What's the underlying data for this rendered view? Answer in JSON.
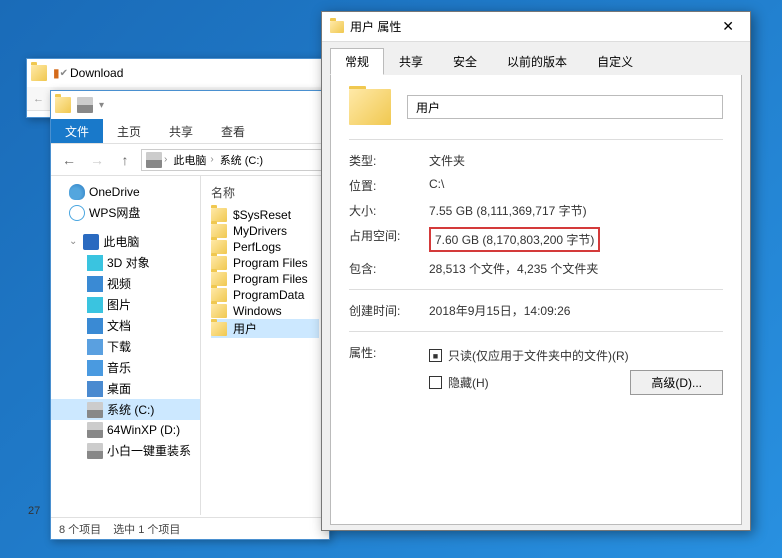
{
  "download_window": {
    "title": "Download",
    "addr_hint": "系统 (C:)"
  },
  "explorer": {
    "ribbon": {
      "file": "文件",
      "home": "主页",
      "share": "共享",
      "view": "查看"
    },
    "breadcrumbs": {
      "pc": "此电脑",
      "drive": "系统 (C:)"
    },
    "tree": {
      "onedrive": "OneDrive",
      "wps": "WPS网盘",
      "thispc": "此电脑",
      "obj3d": "3D 对象",
      "video": "视频",
      "pictures": "图片",
      "docs": "文档",
      "downloads": "下载",
      "music": "音乐",
      "desktop": "桌面",
      "sysdrive": "系统 (C:)",
      "winxp": "64WinXP  (D:)",
      "xiaobai": "小白一键重装系"
    },
    "column_name": "名称",
    "files": [
      "$SysReset",
      "MyDrivers",
      "PerfLogs",
      "Program Files",
      "Program Files",
      "ProgramData",
      "Windows",
      "用户"
    ],
    "status": {
      "count": "8 个项目",
      "selected": "选中 1 个项目"
    },
    "bg_status": "27"
  },
  "props": {
    "title": "用户 属性",
    "tabs": {
      "general": "常规",
      "share": "共享",
      "security": "安全",
      "prev": "以前的版本",
      "custom": "自定义"
    },
    "name": "用户",
    "rows": {
      "type_l": "类型:",
      "type_v": "文件夹",
      "loc_l": "位置:",
      "loc_v": "C:\\",
      "size_l": "大小:",
      "size_v": "7.55 GB (8,111,369,717 字节)",
      "disk_l": "占用空间:",
      "disk_v": "7.60 GB (8,170,803,200 字节)",
      "contains_l": "包含:",
      "contains_v": "28,513 个文件，4,235 个文件夹",
      "created_l": "创建时间:",
      "created_v": "2018年9月15日，14:09:26",
      "attr_l": "属性:",
      "readonly": "只读(仅应用于文件夹中的文件)(R)",
      "hidden": "隐藏(H)",
      "advanced": "高级(D)..."
    }
  }
}
